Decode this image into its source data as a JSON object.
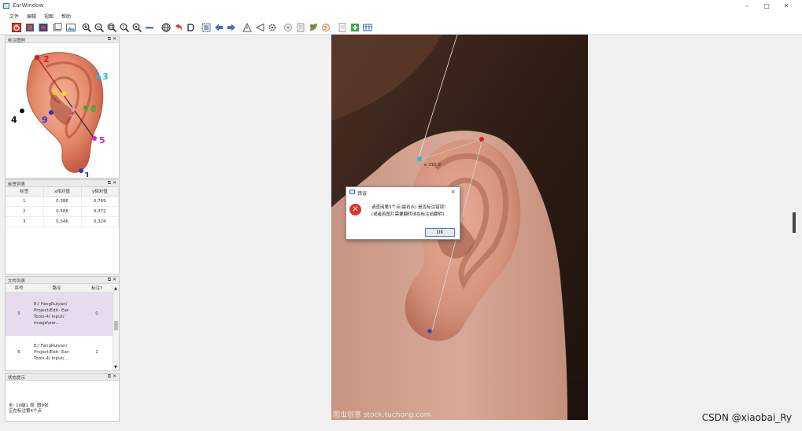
{
  "window": {
    "title": "EarWindow",
    "controls": [
      "–",
      "□",
      "✕"
    ]
  },
  "menu": [
    "文件",
    "编辑",
    "视图",
    "帮助"
  ],
  "toolbar_icons": [
    "power-icon",
    "book-icon",
    "screen-icon",
    "page-icon",
    "image-icon",
    "zoom-in-icon",
    "zoom-out-icon",
    "zoom-fit-icon",
    "zoom-actual-icon",
    "zoom-reset-icon",
    "minus-icon",
    "globe-icon",
    "undo-icon",
    "d-shape-icon",
    "select-box-icon",
    "arrow-left-icon",
    "arrow-right-icon",
    "warning-icon",
    "back-triangle-icon",
    "gear-icon",
    "settings-icon",
    "tag-icon",
    "leaf-icon",
    "brush-icon",
    "document-icon",
    "add-icon",
    "table-icon"
  ],
  "legend_panel": {
    "title": "标注图例",
    "points": [
      {
        "num": "1",
        "color": "#3a34c6"
      },
      {
        "num": "2",
        "color": "#d62020"
      },
      {
        "num": "3",
        "color": "#2ab8d8"
      },
      {
        "num": "4",
        "color": "#111111"
      },
      {
        "num": "5",
        "color": "#cc2fbf"
      },
      {
        "num": "6",
        "color": "#e8d92a"
      },
      {
        "num": "7",
        "color": "#f08fb5"
      },
      {
        "num": "8",
        "color": "#2fae3a"
      },
      {
        "num": "9",
        "color": "#2433c9"
      }
    ]
  },
  "label_panel": {
    "title": "标签列表",
    "headers": [
      "标签",
      "x相对值",
      "y相对值"
    ],
    "rows": [
      [
        "1",
        "0.386",
        "0.769"
      ],
      [
        "2",
        "0.588",
        "0.272"
      ],
      [
        "3",
        "0.346",
        "0.324"
      ]
    ]
  },
  "file_panel": {
    "title": "文件列表",
    "headers": [
      "序号",
      "路径",
      "标注?"
    ],
    "rows": [
      {
        "idx": "5",
        "path": "E:/ FangRuiyan/ Project/Edit- Ear-Tools-4/ input/ image\\ear...",
        "flag": "0",
        "selected": true
      },
      {
        "idx": "6",
        "path": "E:/ FangRuiyan/ Project/Edit- Ear-Tools-4/ input/...",
        "flag": "1",
        "selected": false
      }
    ]
  },
  "status_panel": {
    "title": "状态提示",
    "line1": "全: 10级1 现: 图9张",
    "line2": "正在标注第4个点"
  },
  "image": {
    "point_label": "e_316_0",
    "credit": "图虫创意 stock.tuchong.com"
  },
  "dialog": {
    "title": "错误",
    "close": "×",
    "message_line1": "请查阅第3个点(最右点) 是否标注错误!",
    "message_line2": "(或者若图片需要翻转请在标注前翻转)",
    "ok_label": "OK"
  },
  "watermark": "CSDN @xiaobai_Ry",
  "colors": {
    "accent": "#3c7fd8",
    "error": "#d9342b",
    "selection": "#e6dcee"
  }
}
